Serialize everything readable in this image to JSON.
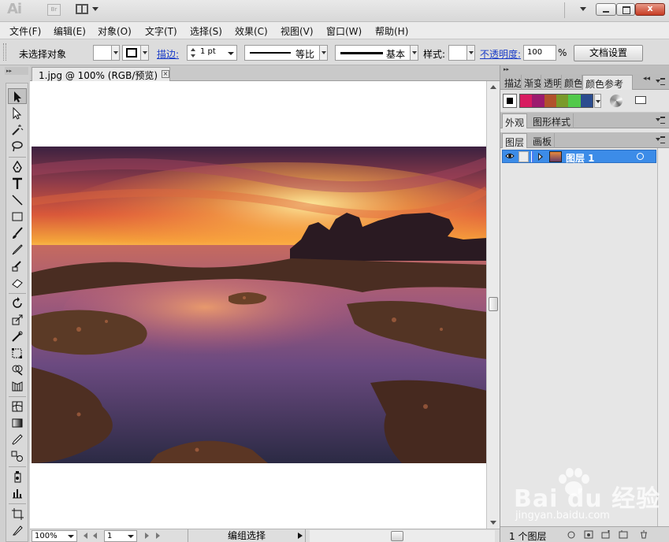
{
  "app": {
    "logo_text": "Ai",
    "bridge_label": "Br",
    "window_close_label": "x"
  },
  "menu": {
    "items": [
      {
        "label": "文件(F)"
      },
      {
        "label": "编辑(E)"
      },
      {
        "label": "对象(O)"
      },
      {
        "label": "文字(T)"
      },
      {
        "label": "选择(S)"
      },
      {
        "label": "效果(C)"
      },
      {
        "label": "视图(V)"
      },
      {
        "label": "窗口(W)"
      },
      {
        "label": "帮助(H)"
      }
    ]
  },
  "control_bar": {
    "selection_status": "未选择对象",
    "stroke_label": "描边:",
    "stroke_weight": "1 pt",
    "profile_label": "等比",
    "brush_label": "基本",
    "style_label": "样式:",
    "opacity_label": "不透明度:",
    "opacity_value": "100",
    "opacity_unit": "%",
    "doc_setup_label": "文档设置"
  },
  "document": {
    "tab_title": "1.jpg @ 100% (RGB/预览)",
    "tab_close": "×"
  },
  "status_bar": {
    "zoom": "100%",
    "page": "1",
    "status_text": "编组选择"
  },
  "panels": {
    "top_tabs": [
      "描边",
      "渐变",
      "透明",
      "颜色",
      "颜色参考"
    ],
    "active_top_tab": "颜色参考",
    "color_guide_swatches": [
      "#d81b60",
      "#9c1b6e",
      "#b1522c",
      "#7a9a2a",
      "#52c94a",
      "#2b4c8f"
    ],
    "mid_tabs": [
      "外观",
      "图形样式"
    ],
    "bottom_tabs": [
      "图层",
      "画板"
    ],
    "layer_name": "图层 1",
    "layers_count": "1 个图层"
  },
  "watermark": {
    "logo_text": "Bai du 经验",
    "url": "jingyan.baidu.com"
  }
}
